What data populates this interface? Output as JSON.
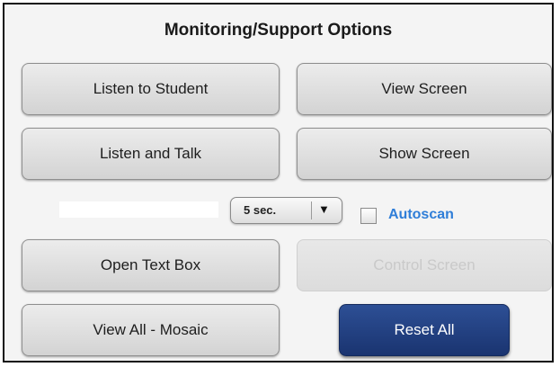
{
  "panel": {
    "title": "Monitoring/Support Options"
  },
  "buttons": {
    "listen_to_student": "Listen to Student",
    "view_screen": "View Screen",
    "listen_and_talk": "Listen and Talk",
    "show_screen": "Show Screen",
    "open_text_box": "Open Text Box",
    "control_screen": "Control Screen",
    "view_all_mosaic": "View All - Mosaic",
    "reset_all": "Reset All"
  },
  "autoscan": {
    "interval_selected": "5 sec.",
    "dropdown_glyph": "▼",
    "label": "Autoscan",
    "checked": false
  },
  "colors": {
    "accent_blue": "#2f7ed8",
    "primary_button": "#1f3b7a",
    "disabled_text": "#c9c9c9"
  },
  "icons": {
    "dropdown_arrow": "chevron-down-icon"
  }
}
